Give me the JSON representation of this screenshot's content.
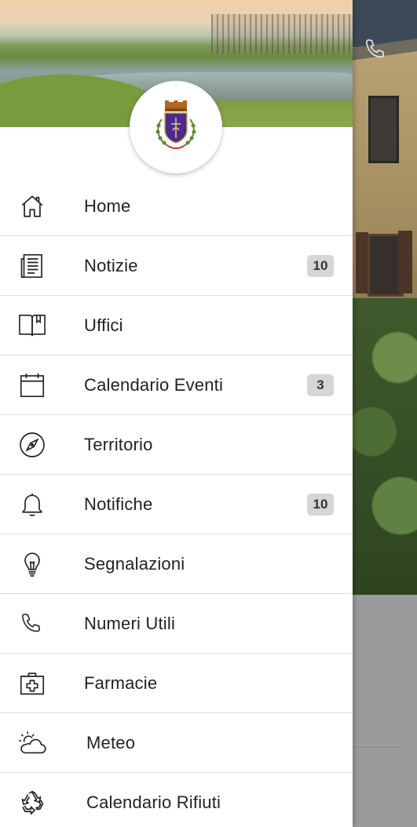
{
  "drawer": {
    "menu": [
      {
        "label": "Home",
        "icon": "home-icon",
        "badge": null
      },
      {
        "label": "Notizie",
        "icon": "newspaper-icon",
        "badge": "10"
      },
      {
        "label": "Uffici",
        "icon": "book-icon",
        "badge": null
      },
      {
        "label": "Calendario Eventi",
        "icon": "calendar-icon",
        "badge": "3"
      },
      {
        "label": "Territorio",
        "icon": "compass-icon",
        "badge": null
      },
      {
        "label": "Notifiche",
        "icon": "bell-icon",
        "badge": "10"
      },
      {
        "label": "Segnalazioni",
        "icon": "lightbulb-icon",
        "badge": null
      },
      {
        "label": "Numeri Utili",
        "icon": "phone-icon",
        "badge": null
      },
      {
        "label": "Farmacie",
        "icon": "first-aid-kit-icon",
        "badge": null
      },
      {
        "label": "Meteo",
        "icon": "weather-icon",
        "badge": null
      },
      {
        "label": "Calendario Rifiuti",
        "icon": "recycle-icon",
        "badge": null
      }
    ]
  },
  "colors": {
    "drawer_bg": "#ffffff",
    "badge_bg": "#d6d6d6",
    "text": "#222222",
    "divider": "#dcdcdc"
  }
}
